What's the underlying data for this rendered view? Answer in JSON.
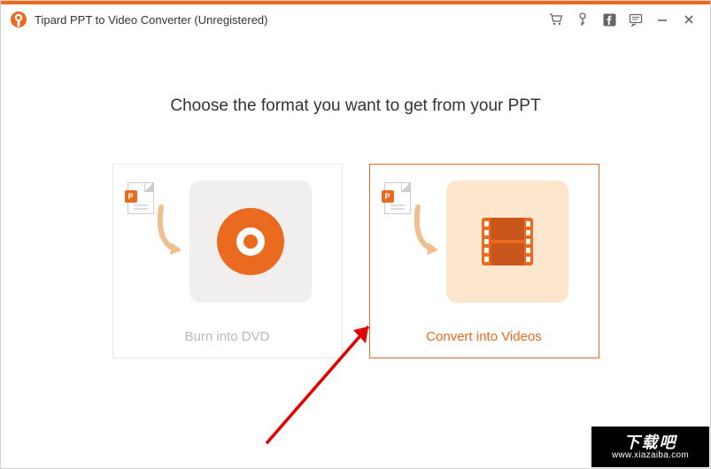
{
  "header": {
    "title": "Tipard PPT to Video Converter (Unregistered)"
  },
  "main": {
    "heading": "Choose the format you want to get from your PPT",
    "options": {
      "dvd": {
        "label": "Burn into DVD",
        "selected": false
      },
      "video": {
        "label": "Convert into Videos",
        "selected": true
      }
    }
  },
  "watermark": {
    "text": "下载吧",
    "url": "www.xiazaiba.com"
  }
}
